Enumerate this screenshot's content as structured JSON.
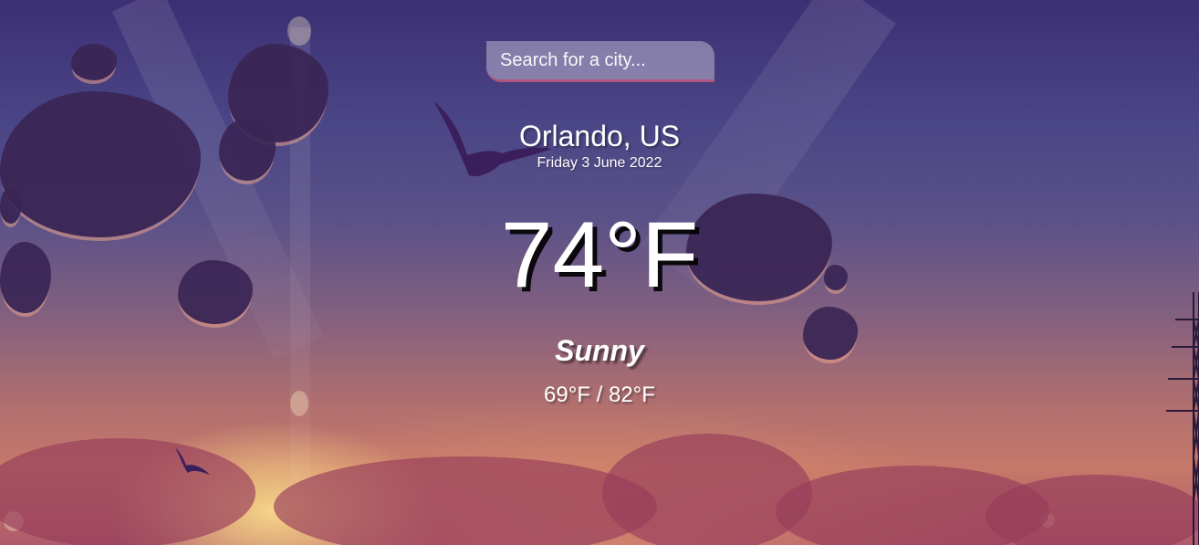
{
  "search": {
    "placeholder": "Search for a city...",
    "value": ""
  },
  "location": {
    "city": "Orlando, US",
    "date": "Friday 3 June 2022"
  },
  "weather": {
    "temperature": "74°F",
    "condition": "Sunny",
    "hi_low": "69°F / 82°F"
  },
  "colors": {
    "accent": "#b0557f",
    "text": "#ffffff"
  },
  "icons": [
    "bird-icon",
    "power-tower-icon"
  ]
}
